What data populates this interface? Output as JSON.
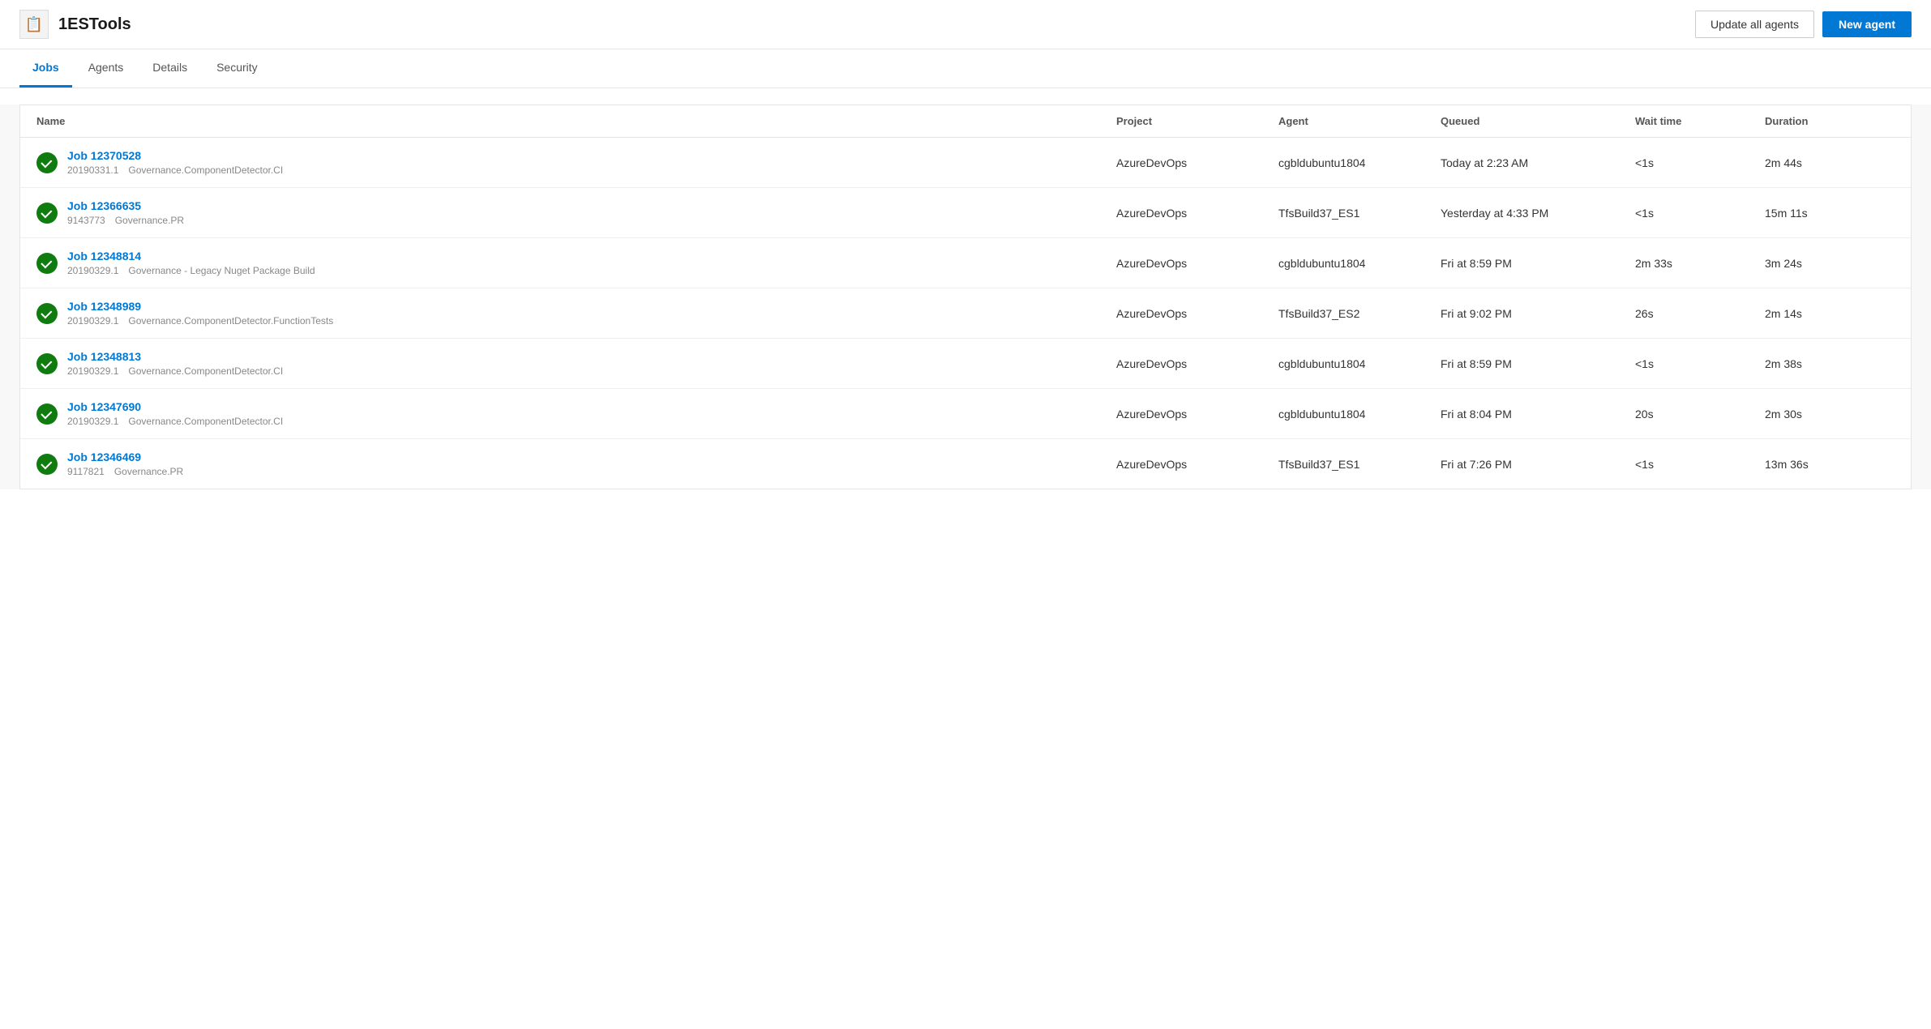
{
  "header": {
    "icon": "📋",
    "title": "1ESTools",
    "update_agents_label": "Update all agents",
    "new_agent_label": "New agent"
  },
  "tabs": [
    {
      "id": "jobs",
      "label": "Jobs",
      "active": true
    },
    {
      "id": "agents",
      "label": "Agents",
      "active": false
    },
    {
      "id": "details",
      "label": "Details",
      "active": false
    },
    {
      "id": "security",
      "label": "Security",
      "active": false
    }
  ],
  "table": {
    "columns": [
      {
        "key": "name",
        "label": "Name"
      },
      {
        "key": "project",
        "label": "Project"
      },
      {
        "key": "agent",
        "label": "Agent"
      },
      {
        "key": "queued",
        "label": "Queued"
      },
      {
        "key": "wait_time",
        "label": "Wait time"
      },
      {
        "key": "duration",
        "label": "Duration"
      }
    ],
    "rows": [
      {
        "id": "job-12370528",
        "job_name": "Job 12370528",
        "job_id": "20190331.1",
        "job_desc": "Governance.ComponentDetector.CI",
        "project": "AzureDevOps",
        "agent": "cgbldubuntu1804",
        "queued": "Today at 2:23 AM",
        "wait_time": "<1s",
        "duration": "2m 44s",
        "status": "success"
      },
      {
        "id": "job-12366635",
        "job_name": "Job 12366635",
        "job_id": "9143773",
        "job_desc": "Governance.PR",
        "project": "AzureDevOps",
        "agent": "TfsBuild37_ES1",
        "queued": "Yesterday at 4:33 PM",
        "wait_time": "<1s",
        "duration": "15m 11s",
        "status": "success"
      },
      {
        "id": "job-12348814",
        "job_name": "Job 12348814",
        "job_id": "20190329.1",
        "job_desc": "Governance - Legacy Nuget Package Build",
        "project": "AzureDevOps",
        "agent": "cgbldubuntu1804",
        "queued": "Fri at 8:59 PM",
        "wait_time": "2m 33s",
        "duration": "3m 24s",
        "status": "success"
      },
      {
        "id": "job-12348989",
        "job_name": "Job 12348989",
        "job_id": "20190329.1",
        "job_desc": "Governance.ComponentDetector.FunctionTests",
        "project": "AzureDevOps",
        "agent": "TfsBuild37_ES2",
        "queued": "Fri at 9:02 PM",
        "wait_time": "26s",
        "duration": "2m 14s",
        "status": "success"
      },
      {
        "id": "job-12348813",
        "job_name": "Job 12348813",
        "job_id": "20190329.1",
        "job_desc": "Governance.ComponentDetector.CI",
        "project": "AzureDevOps",
        "agent": "cgbldubuntu1804",
        "queued": "Fri at 8:59 PM",
        "wait_time": "<1s",
        "duration": "2m 38s",
        "status": "success"
      },
      {
        "id": "job-12347690",
        "job_name": "Job 12347690",
        "job_id": "20190329.1",
        "job_desc": "Governance.ComponentDetector.CI",
        "project": "AzureDevOps",
        "agent": "cgbldubuntu1804",
        "queued": "Fri at 8:04 PM",
        "wait_time": "20s",
        "duration": "2m 30s",
        "status": "success"
      },
      {
        "id": "job-12346469",
        "job_name": "Job 12346469",
        "job_id": "9117821",
        "job_desc": "Governance.PR",
        "project": "AzureDevOps",
        "agent": "TfsBuild37_ES1",
        "queued": "Fri at 7:26 PM",
        "wait_time": "<1s",
        "duration": "13m 36s",
        "status": "success"
      }
    ]
  }
}
